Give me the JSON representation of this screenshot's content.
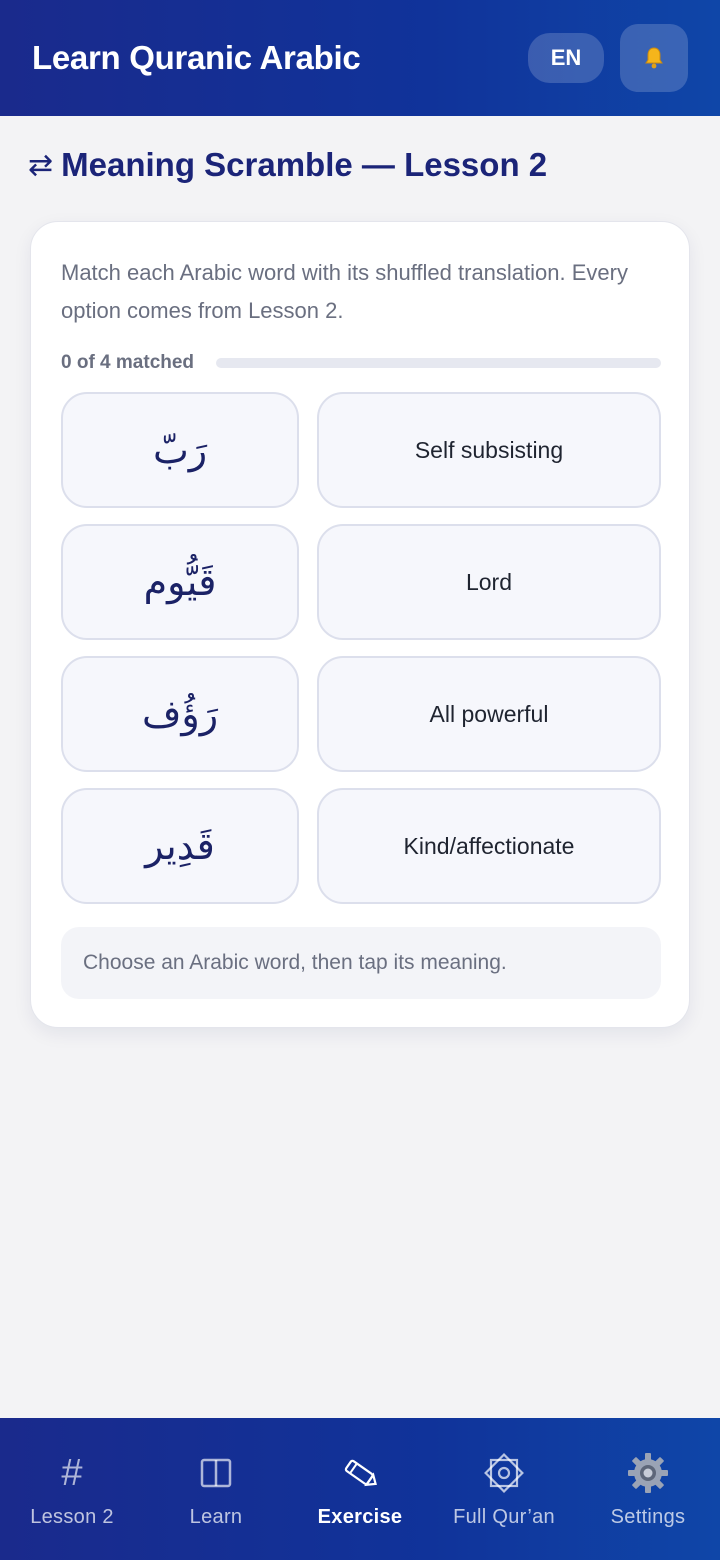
{
  "header": {
    "title": "Learn Quranic Arabic",
    "lang_label": "EN",
    "bell_icon": "bell-icon"
  },
  "section": {
    "title": "Meaning Scramble — Lesson 2",
    "icon": "swap-arrows-icon"
  },
  "card": {
    "instructions": "Match each Arabic word with its shuffled translation. Every option comes from Lesson 2.",
    "progress_label": "0 of 4 matched",
    "progress_fraction": 0,
    "arabic_words": [
      "رَبّ",
      "قَيُّوم",
      "رَؤُف",
      "قَدِير"
    ],
    "meanings": [
      "Self subsisting",
      "Lord",
      "All powerful",
      "Kind/affectionate"
    ],
    "hint": "Choose an Arabic word, then tap its meaning."
  },
  "nav": {
    "items": [
      {
        "label": "Lesson 2",
        "icon": "hash-icon",
        "active": false
      },
      {
        "label": "Learn",
        "icon": "book-icon",
        "active": false
      },
      {
        "label": "Exercise",
        "icon": "pencil-icon",
        "active": true
      },
      {
        "label": "Full Qur’an",
        "icon": "star-octagram-icon",
        "active": false
      },
      {
        "label": "Settings",
        "icon": "gear-icon",
        "active": false
      }
    ]
  },
  "colors": {
    "brand": "#1a2a8c",
    "title_text": "#1b2478",
    "muted_text": "#6a6f80"
  }
}
